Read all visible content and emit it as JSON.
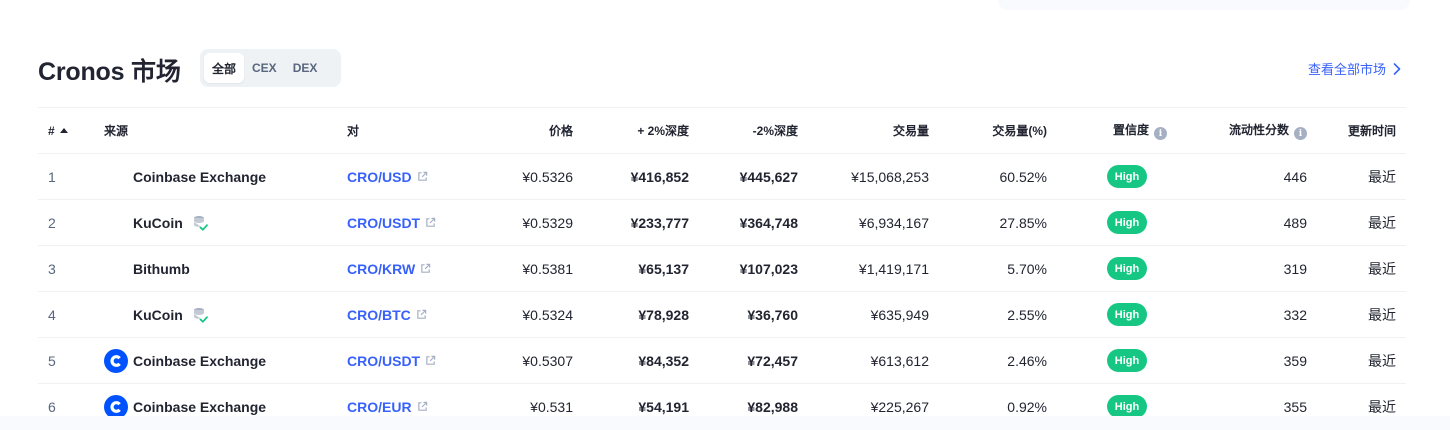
{
  "header": {
    "title": "Cronos 市场",
    "filters": [
      {
        "label": "全部",
        "active": true
      },
      {
        "label": "CEX",
        "active": false
      },
      {
        "label": "DEX",
        "active": false
      }
    ],
    "view_all_label": "查看全部市场"
  },
  "table": {
    "columns": {
      "num": "#",
      "source": "来源",
      "pair": "对",
      "price": "价格",
      "depth_plus": "+ 2%深度",
      "depth_minus": "-2%深度",
      "volume": "交易量",
      "volume_pct": "交易量(%)",
      "confidence": "置信度",
      "liquidity": "流动性分数",
      "updated": "更新时间"
    },
    "rows": [
      {
        "num": "1",
        "source": "Coinbase Exchange",
        "logo": "none",
        "verified": false,
        "pair": "CRO/USD",
        "price": "¥0.5326",
        "depth_plus": "¥416,852",
        "depth_minus": "¥445,627",
        "volume": "¥15,068,253",
        "volume_pct": "60.52%",
        "confidence": "High",
        "liquidity": "446",
        "updated": "最近"
      },
      {
        "num": "2",
        "source": "KuCoin",
        "logo": "none",
        "verified": true,
        "pair": "CRO/USDT",
        "price": "¥0.5329",
        "depth_plus": "¥233,777",
        "depth_minus": "¥364,748",
        "volume": "¥6,934,167",
        "volume_pct": "27.85%",
        "confidence": "High",
        "liquidity": "489",
        "updated": "最近"
      },
      {
        "num": "3",
        "source": "Bithumb",
        "logo": "none",
        "verified": false,
        "pair": "CRO/KRW",
        "price": "¥0.5381",
        "depth_plus": "¥65,137",
        "depth_minus": "¥107,023",
        "volume": "¥1,419,171",
        "volume_pct": "5.70%",
        "confidence": "High",
        "liquidity": "319",
        "updated": "最近"
      },
      {
        "num": "4",
        "source": "KuCoin",
        "logo": "none",
        "verified": true,
        "pair": "CRO/BTC",
        "price": "¥0.5324",
        "depth_plus": "¥78,928",
        "depth_minus": "¥36,760",
        "volume": "¥635,949",
        "volume_pct": "2.55%",
        "confidence": "High",
        "liquidity": "332",
        "updated": "最近"
      },
      {
        "num": "5",
        "source": "Coinbase Exchange",
        "logo": "coinbase",
        "verified": false,
        "pair": "CRO/USDT",
        "price": "¥0.5307",
        "depth_plus": "¥84,352",
        "depth_minus": "¥72,457",
        "volume": "¥613,612",
        "volume_pct": "2.46%",
        "confidence": "High",
        "liquidity": "359",
        "updated": "最近"
      },
      {
        "num": "6",
        "source": "Coinbase Exchange",
        "logo": "coinbase",
        "verified": false,
        "pair": "CRO/EUR",
        "price": "¥0.531",
        "depth_plus": "¥54,191",
        "depth_minus": "¥82,988",
        "volume": "¥225,267",
        "volume_pct": "0.92%",
        "confidence": "High",
        "liquidity": "355",
        "updated": "最近"
      }
    ]
  },
  "colors": {
    "accent": "#3861fb",
    "high_badge": "#16c784",
    "text": "#222531",
    "muted": "#58667e"
  }
}
